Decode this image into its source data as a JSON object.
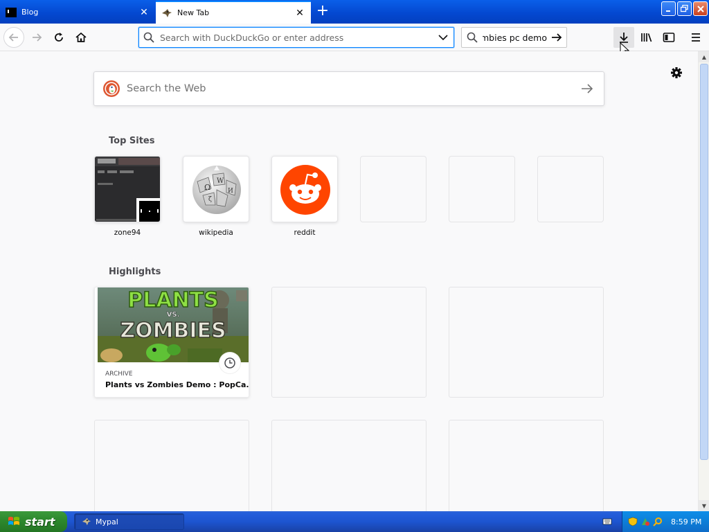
{
  "tabs": [
    {
      "title": "Blog",
      "icon": "blog-favicon-icon",
      "active": false
    },
    {
      "title": "New Tab",
      "icon": "mypal-favicon-icon",
      "active": true
    }
  ],
  "toolbar": {
    "url_placeholder": "Search with DuckDuckGo or enter address",
    "search_value": "Plants vs Zombies pc demo"
  },
  "newtab": {
    "search_placeholder": "Search the Web",
    "top_sites_title": "Top Sites",
    "top_sites": [
      {
        "label": "zone94"
      },
      {
        "label": "wikipedia"
      },
      {
        "label": "reddit"
      },
      {
        "label": ""
      },
      {
        "label": ""
      },
      {
        "label": ""
      }
    ],
    "highlights_title": "Highlights",
    "highlight": {
      "source": "ARCHIVE",
      "title": "Plants vs Zombies Demo : PopCa..."
    }
  },
  "taskbar": {
    "start_label": "start",
    "task_label": "Mypal",
    "clock": "8:59 PM"
  },
  "colors": {
    "accent": "#0a84ff",
    "reddit": "#ff4500",
    "xp_blue": "#245edb",
    "xp_green": "#2e8a2e"
  }
}
